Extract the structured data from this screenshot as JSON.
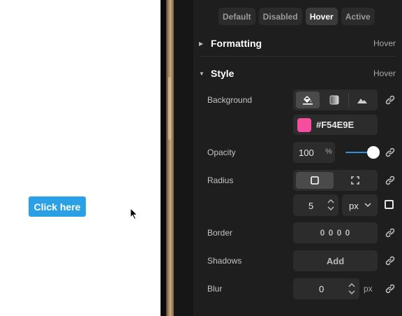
{
  "canvas": {
    "button_label": "Click here"
  },
  "state_tabs": [
    {
      "label": "Default"
    },
    {
      "label": "Disabled"
    },
    {
      "label": "Hover",
      "active": true
    },
    {
      "label": "Active"
    }
  ],
  "formatting": {
    "title": "Formatting",
    "state": "Hover"
  },
  "style": {
    "title": "Style",
    "state": "Hover",
    "background": {
      "label": "Background",
      "color_hex": "#F54E9E",
      "color_text": "#F54E9E"
    },
    "opacity": {
      "label": "Opacity",
      "value": "100",
      "unit": "%",
      "level": 1.0
    },
    "radius": {
      "label": "Radius",
      "value": "5",
      "unit": "px"
    },
    "border": {
      "label": "Border",
      "value": "0 0 0 0"
    },
    "shadows": {
      "label": "Shadows",
      "add_label": "Add"
    },
    "blur": {
      "label": "Blur",
      "value": "0",
      "unit": "px"
    }
  },
  "colors": {
    "accent": "#2F8FE0",
    "button_blue": "#2AA0E6",
    "swatch": "#F54E9E"
  }
}
